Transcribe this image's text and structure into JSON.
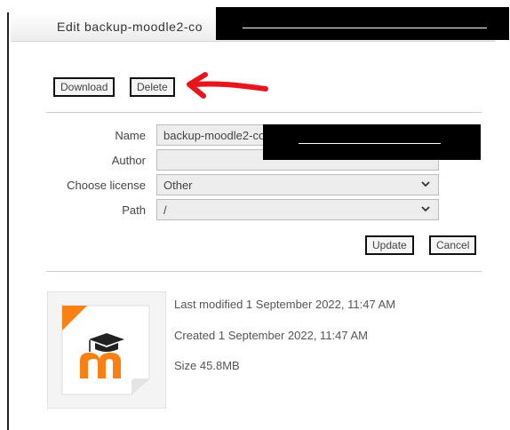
{
  "dialog": {
    "title": "Edit backup-moodle2-co"
  },
  "actions": {
    "download_label": "Download",
    "delete_label": "Delete"
  },
  "form": {
    "name_label": "Name",
    "name_value": "backup-moodle2-co",
    "author_label": "Author",
    "author_value": "",
    "license_label": "Choose license",
    "license_value": "Other",
    "path_label": "Path",
    "path_value": "/",
    "update_label": "Update",
    "cancel_label": "Cancel"
  },
  "file_info": {
    "last_modified": "Last modified 1 September 2022, 11:47 AM",
    "created": "Created 1 September 2022, 11:47 AM",
    "size": "Size 45.8MB"
  },
  "colors": {
    "annotation_red": "#e8161c",
    "moodle_orange": "#f98012"
  },
  "icons": {
    "file_thumbnail": "moodle-logo-icon",
    "select_arrow": "chevron-down-icon"
  }
}
